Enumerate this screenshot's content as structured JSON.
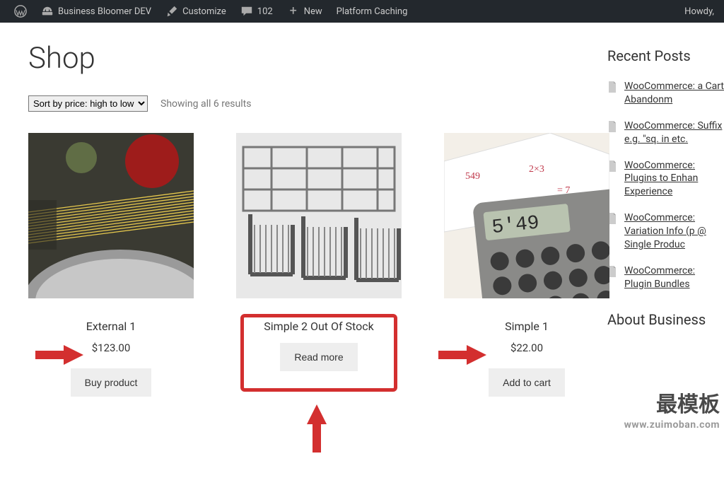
{
  "admin_bar": {
    "site_name": "Business Bloomer DEV",
    "customize": "Customize",
    "comments_count": "102",
    "new": "New",
    "platform_caching": "Platform Caching",
    "howdy": "Howdy,"
  },
  "page_title": "Shop",
  "sort_selected": "Sort by price: high to low",
  "result_count": "Showing all 6 results",
  "products": [
    {
      "title": "External 1",
      "price": "$123.00",
      "button": "Buy product"
    },
    {
      "title": "Simple 2 Out Of Stock",
      "price": "",
      "button": "Read more"
    },
    {
      "title": "Simple 1",
      "price": "$22.00",
      "button": "Add to cart"
    }
  ],
  "sidebar": {
    "recent_title": "Recent Posts",
    "posts": [
      "WooCommerce:  a Cart Abandonm",
      "WooCommerce:  Suffix e.g. \"sq. in etc.",
      "WooCommerce:  Plugins to Enhan Experience",
      "WooCommerce:  Variation Info (p @ Single Produc",
      "WooCommerce:  Plugin Bundles"
    ],
    "about_title": "About Business"
  },
  "watermark": {
    "cn": "最模板",
    "url": "www.zuimoban.com"
  }
}
